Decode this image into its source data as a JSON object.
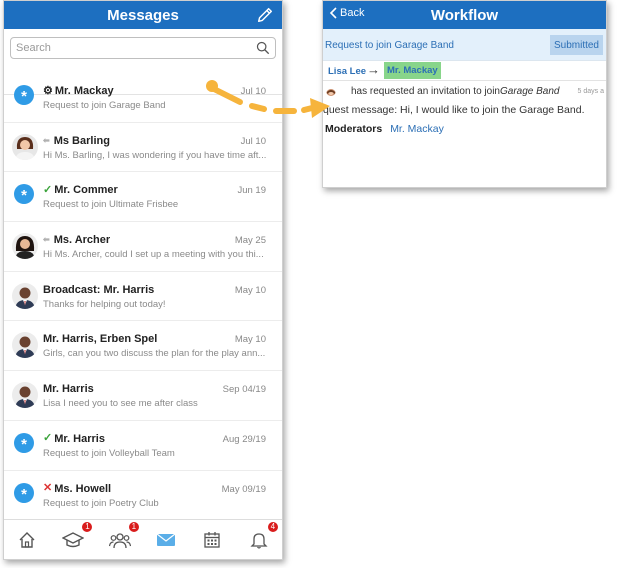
{
  "messages": {
    "title": "Messages",
    "search_placeholder": "Search",
    "items": [
      {
        "sender": "Mr. Mackay",
        "date": "Jul 10",
        "preview": "Request to join Garage Band",
        "avatar": "asterisk",
        "marker": "gear"
      },
      {
        "sender": "Ms Barling",
        "date": "Jul 10",
        "preview": "Hi Ms. Barling, I was wondering if you have time aft...",
        "avatar": "photo-woman-1",
        "marker": "reply"
      },
      {
        "sender": "Mr. Commer",
        "date": "Jun 19",
        "preview": "Request to join Ultimate Frisbee",
        "avatar": "asterisk",
        "marker": "check"
      },
      {
        "sender": "Ms. Archer",
        "date": "May 25",
        "preview": "Hi Ms. Archer, could I set up a meeting with you thi...",
        "avatar": "photo-woman-2",
        "marker": "reply"
      },
      {
        "sender": "Broadcast: Mr. Harris",
        "date": "May 10",
        "preview": "Thanks for helping out today!",
        "avatar": "photo-man",
        "marker": ""
      },
      {
        "sender": "Mr. Harris, Erben Spel",
        "date": "May 10",
        "preview": "Girls, can you two discuss the plan for the play ann...",
        "avatar": "photo-man",
        "marker": ""
      },
      {
        "sender": "Mr. Harris",
        "date": "Sep 04/19",
        "preview": "Lisa I need you to see me after class",
        "avatar": "photo-man",
        "marker": ""
      },
      {
        "sender": "Mr. Harris",
        "date": "Aug 29/19",
        "preview": "Request to join Volleyball Team",
        "avatar": "asterisk",
        "marker": "check"
      },
      {
        "sender": "Ms. Howell",
        "date": "May 09/19",
        "preview": "Request to join Poetry Club",
        "avatar": "asterisk",
        "marker": "cross"
      }
    ],
    "tabs": [
      {
        "icon": "home-icon",
        "badge": ""
      },
      {
        "icon": "graduation-cap-icon",
        "badge": "1"
      },
      {
        "icon": "people-icon",
        "badge": "1"
      },
      {
        "icon": "mail-icon",
        "badge": ""
      },
      {
        "icon": "calendar-icon",
        "badge": ""
      },
      {
        "icon": "bell-icon",
        "badge": "4"
      }
    ]
  },
  "workflow": {
    "back_label": "Back",
    "title": "Workflow",
    "request_title": "Request to join Garage Band",
    "status": "Submitted",
    "from": "Lisa Lee",
    "to": "Mr. Mackay",
    "note_prefix": "has requested an invitation to join",
    "note_group": "Garage Band",
    "note_age": "5 days a",
    "request_message": "quest message: Hi, I would like to join the Garage Band.",
    "moderators_label": "Moderators",
    "moderators_value": "Mr. Mackay"
  },
  "colors": {
    "header_blue": "#1d6fc0",
    "link_blue": "#2c6fb5",
    "badge_red": "#d91c1c",
    "highlight_green": "#88d58a",
    "annotation_orange": "#f6b43c"
  }
}
